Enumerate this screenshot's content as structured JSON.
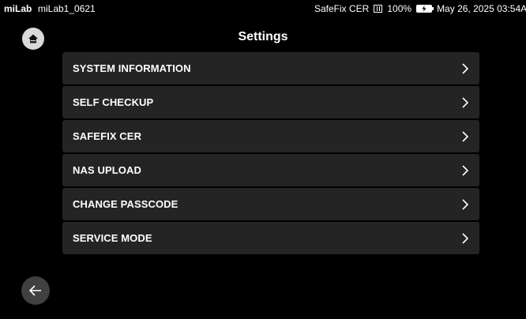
{
  "status_bar": {
    "brand": "miLab",
    "device_name": "miLab1_0621",
    "safefix_label": "SafeFix CER",
    "signal_icon": "signal-bars-icon",
    "battery_percent": "100%",
    "battery_icon": "battery-charging-icon",
    "datetime": "May 26, 2025 03:54AM"
  },
  "header": {
    "title": "Settings",
    "home_icon": "home-icon"
  },
  "menu": {
    "items": [
      {
        "label": "SYSTEM INFORMATION"
      },
      {
        "label": "SELF CHECKUP"
      },
      {
        "label": "SAFEFIX CER"
      },
      {
        "label": "NAS UPLOAD"
      },
      {
        "label": "CHANGE PASSCODE"
      },
      {
        "label": "SERVICE MODE"
      }
    ],
    "chevron_icon": "chevron-right-icon"
  },
  "footer": {
    "back_icon": "arrow-left-icon"
  },
  "colors": {
    "background": "#000000",
    "menu_item_bg": "#242424",
    "home_button_bg": "#d9d9d9",
    "back_button_bg": "#404040",
    "text": "#ffffff"
  }
}
